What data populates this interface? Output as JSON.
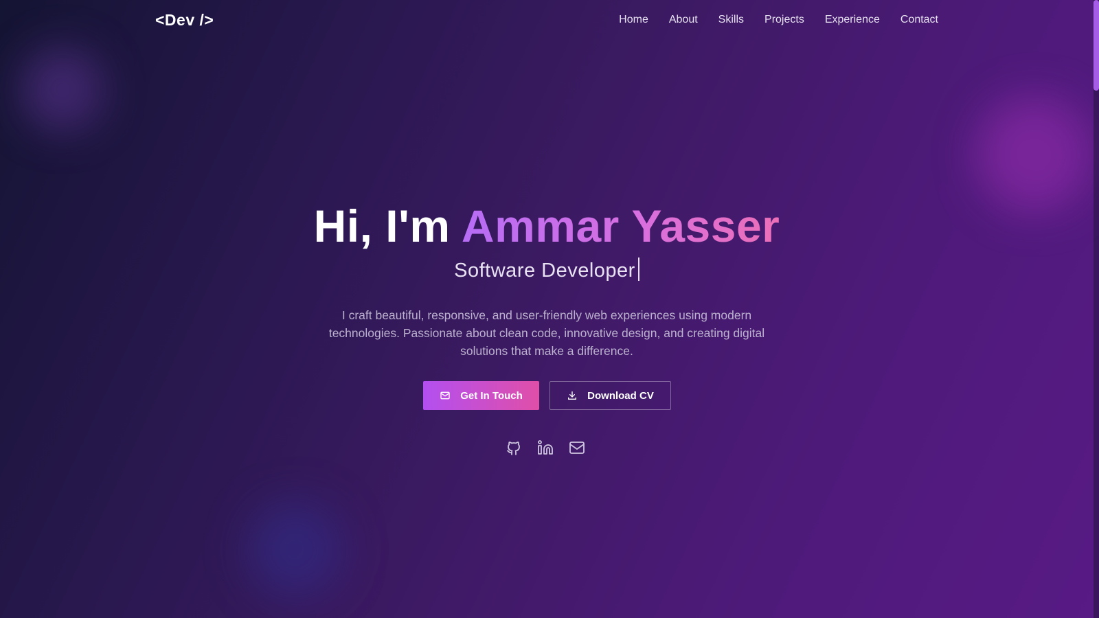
{
  "nav": {
    "logo": "<Dev />",
    "links": [
      "Home",
      "About",
      "Skills",
      "Projects",
      "Experience",
      "Contact"
    ]
  },
  "hero": {
    "greeting": "Hi, I'm ",
    "name": "Ammar Yasser",
    "role": "Software Developer",
    "intro": "I craft beautiful, responsive, and user-friendly web experiences using modern technologies. Passionate about clean code, innovative design, and creating digital solutions that make a difference.",
    "primary_button": "Get In Touch",
    "secondary_button": "Download CV"
  },
  "socials": [
    {
      "icon": "github-icon"
    },
    {
      "icon": "linkedin-icon"
    },
    {
      "icon": "mail-icon"
    }
  ],
  "colors": {
    "accent_start": "#b34ff0",
    "accent_end": "#e04fa8",
    "name_gradient_start": "#b66df5",
    "name_gradient_end": "#ec6fb8",
    "background_dark": "#141433",
    "background_purple": "#581a85"
  }
}
